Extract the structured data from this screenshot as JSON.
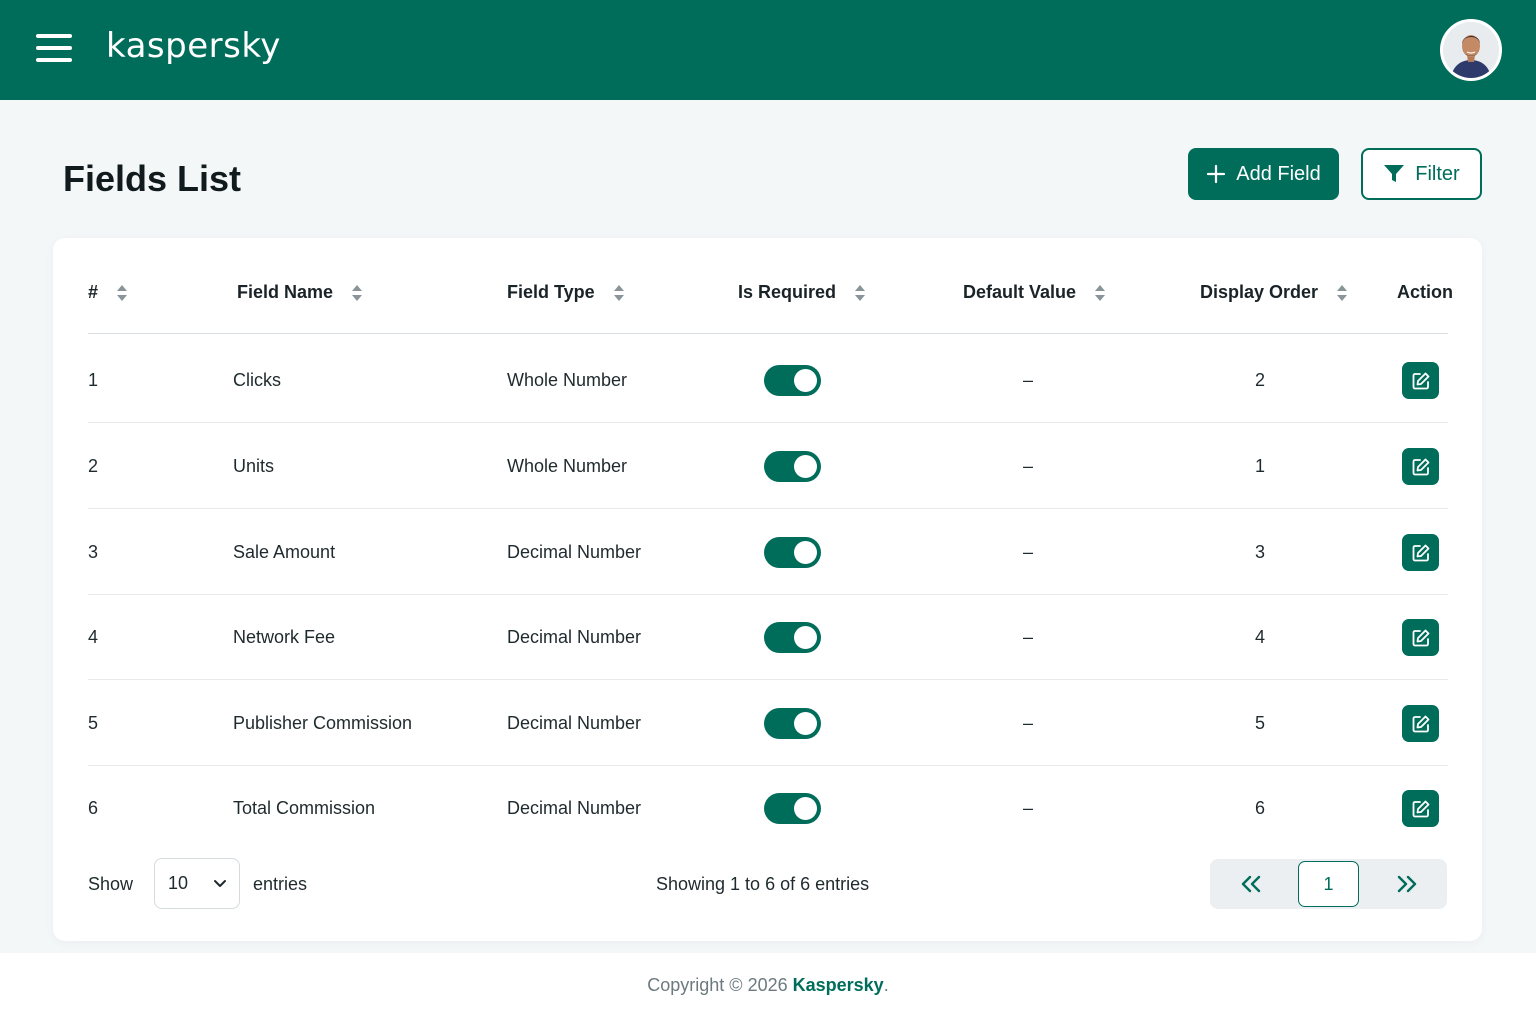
{
  "header": {
    "logo": "kaspersky",
    "menu_icon": "hamburger-menu-icon",
    "avatar_icon": "user-avatar"
  },
  "page": {
    "title": "Fields List",
    "add_button_label": "Add Field",
    "filter_button_label": "Filter"
  },
  "table": {
    "columns": [
      "#",
      "Field Name",
      "Field Type",
      "Is Required",
      "Default Value",
      "Display Order",
      "Action"
    ],
    "rows": [
      {
        "id": "1",
        "name": "Clicks",
        "type": "Whole Number",
        "required": true,
        "default": "–",
        "order": "2"
      },
      {
        "id": "2",
        "name": "Units",
        "type": "Whole Number",
        "required": true,
        "default": "–",
        "order": "1"
      },
      {
        "id": "3",
        "name": "Sale Amount",
        "type": "Decimal Number",
        "required": true,
        "default": "–",
        "order": "3"
      },
      {
        "id": "4",
        "name": "Network Fee",
        "type": "Decimal Number",
        "required": true,
        "default": "–",
        "order": "4"
      },
      {
        "id": "5",
        "name": "Publisher Commission",
        "type": "Decimal Number",
        "required": true,
        "default": "–",
        "order": "5"
      },
      {
        "id": "6",
        "name": "Total Commission",
        "type": "Decimal Number",
        "required": true,
        "default": "–",
        "order": "6"
      }
    ]
  },
  "footer": {
    "show_label": "Show",
    "page_size": "10",
    "entries_label": "entries",
    "showing_text": "Showing 1 to 6 of 6 entries",
    "current_page": "1"
  },
  "copyright": {
    "prefix": "Copyright © 2026 ",
    "brand": "Kaspersky",
    "suffix": "."
  },
  "colors": {
    "brand": "#006d5b",
    "background": "#f3f7f8"
  }
}
